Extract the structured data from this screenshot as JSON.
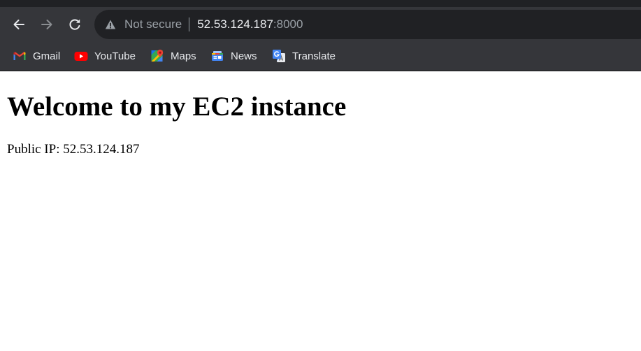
{
  "browser": {
    "security_label": "Not secure",
    "url_host": "52.53.124.187",
    "url_port": ":8000"
  },
  "bookmarks": [
    {
      "label": "Gmail",
      "icon": "gmail-icon"
    },
    {
      "label": "YouTube",
      "icon": "youtube-icon"
    },
    {
      "label": "Maps",
      "icon": "maps-icon"
    },
    {
      "label": "News",
      "icon": "news-icon"
    },
    {
      "label": "Translate",
      "icon": "translate-icon"
    }
  ],
  "page": {
    "heading": "Welcome to my EC2 instance",
    "paragraph": "Public IP: 52.53.124.187"
  },
  "colors": {
    "chrome_bg": "#35363a",
    "omnibox_bg": "#202124",
    "chrome_text": "#e8eaed",
    "chrome_muted_text": "#9aa0a6",
    "page_bg": "#ffffff"
  }
}
